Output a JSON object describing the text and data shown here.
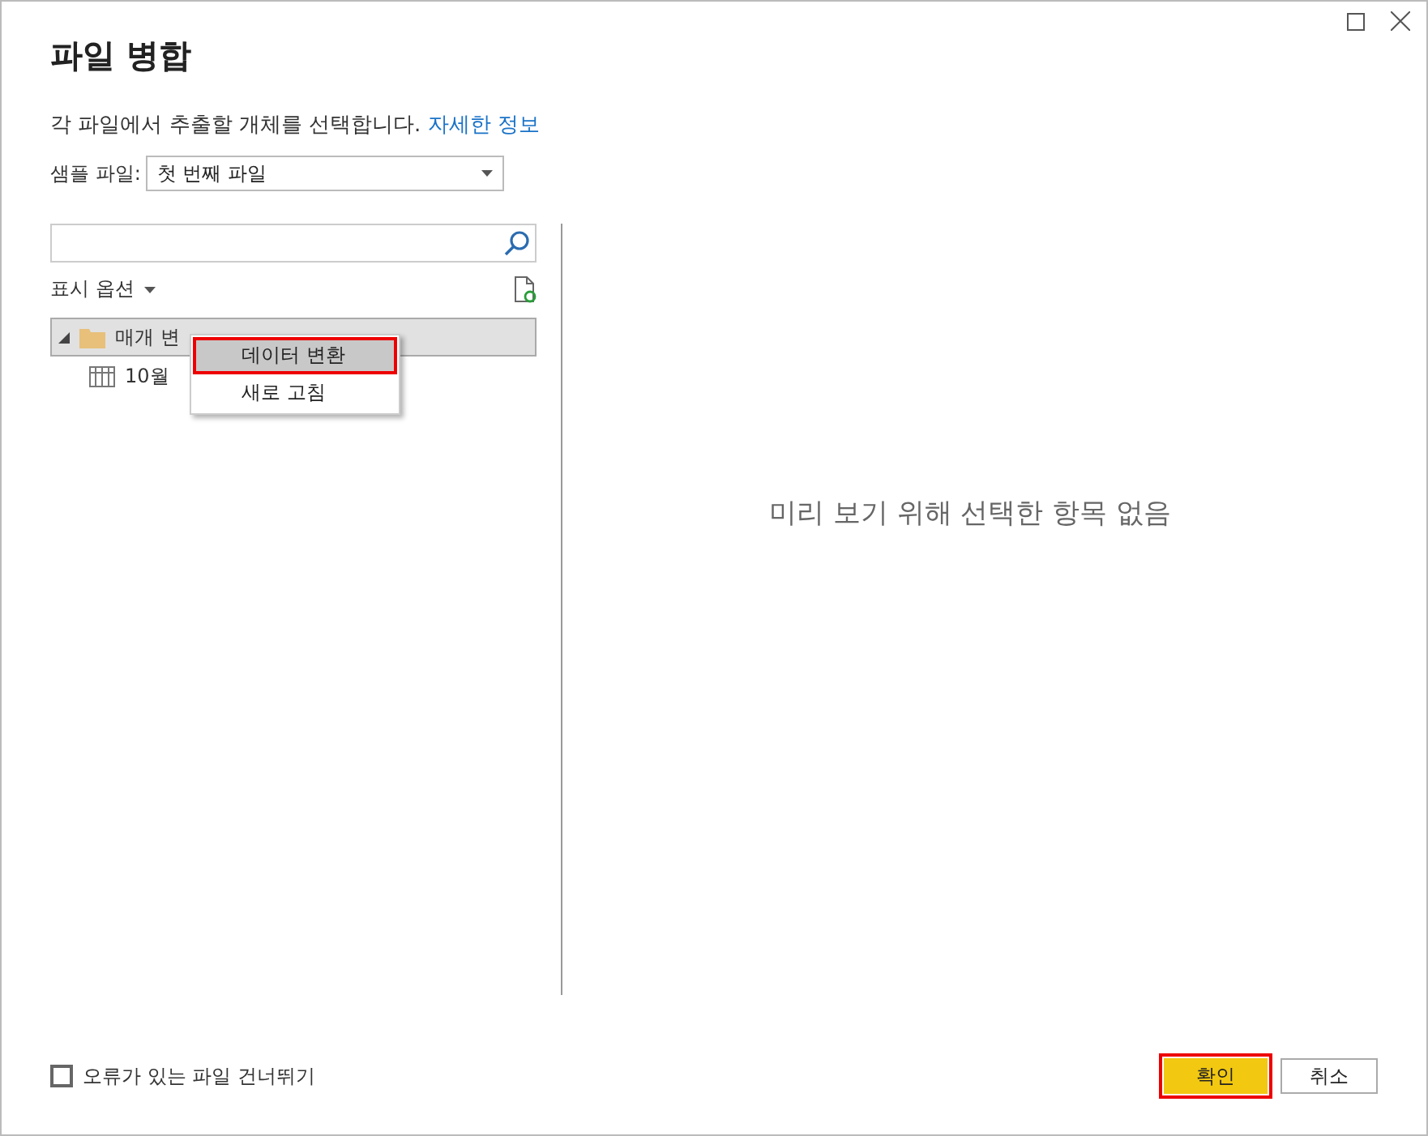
{
  "window": {
    "title": "파일 병합"
  },
  "description": {
    "text": "각 파일에서 추출할 개체를 선택합니다.",
    "link": "자세한 정보"
  },
  "sample_file": {
    "label": "샘플 파일:",
    "value": "첫 번째 파일"
  },
  "display_options": {
    "label": "표시 옵션"
  },
  "tree": [
    {
      "label": "매개 변",
      "expanded": true,
      "selected": true,
      "children": [
        {
          "label": "10월"
        }
      ]
    }
  ],
  "context_menu": [
    {
      "label": "데이터 변환",
      "selected": true
    },
    {
      "label": "새로 고침",
      "selected": false
    }
  ],
  "preview": {
    "empty_text": "미리 보기 위해 선택한 항목 없음"
  },
  "skip_errors": {
    "label": "오류가 있는 파일 건너뛰기",
    "checked": false
  },
  "buttons": [
    {
      "label": "확인",
      "kind": "primary",
      "highlighted": true
    },
    {
      "label": "취소",
      "kind": "secondary",
      "highlighted": false
    }
  ]
}
